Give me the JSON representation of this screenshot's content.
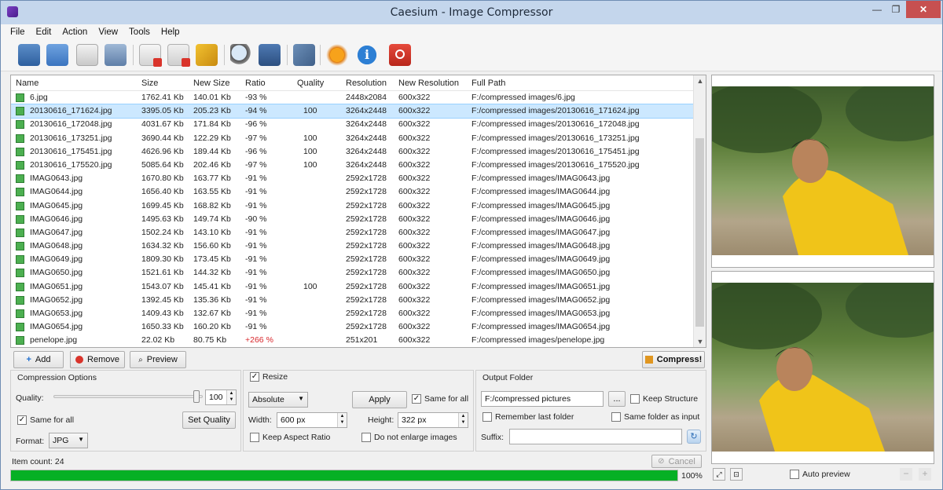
{
  "window": {
    "title": "Caesium - Image Compressor",
    "min": "—",
    "max": "❐",
    "close": "✕"
  },
  "menu": [
    "File",
    "Edit",
    "Action",
    "View",
    "Tools",
    "Help"
  ],
  "list": {
    "columns": [
      "Name",
      "Size",
      "New Size",
      "Ratio",
      "Quality",
      "Resolution",
      "New Resolution",
      "Full Path"
    ],
    "rows": [
      [
        "6.jpg",
        "1762.41 Kb",
        "140.01 Kb",
        "-93 %",
        "",
        "2448x2084",
        "600x322",
        "F:/compressed images/6.jpg"
      ],
      [
        "20130616_171624.jpg",
        "3395.05 Kb",
        "205.23 Kb",
        "-94 %",
        "100",
        "3264x2448",
        "600x322",
        "F:/compressed images/20130616_171624.jpg"
      ],
      [
        "20130616_172048.jpg",
        "4031.67 Kb",
        "171.84 Kb",
        "-96 %",
        "",
        "3264x2448",
        "600x322",
        "F:/compressed images/20130616_172048.jpg"
      ],
      [
        "20130616_173251.jpg",
        "3690.44 Kb",
        "122.29 Kb",
        "-97 %",
        "100",
        "3264x2448",
        "600x322",
        "F:/compressed images/20130616_173251.jpg"
      ],
      [
        "20130616_175451.jpg",
        "4626.96 Kb",
        "189.44 Kb",
        "-96 %",
        "100",
        "3264x2448",
        "600x322",
        "F:/compressed images/20130616_175451.jpg"
      ],
      [
        "20130616_175520.jpg",
        "5085.64 Kb",
        "202.46 Kb",
        "-97 %",
        "100",
        "3264x2448",
        "600x322",
        "F:/compressed images/20130616_175520.jpg"
      ],
      [
        "IMAG0643.jpg",
        "1670.80 Kb",
        "163.77 Kb",
        "-91 %",
        "",
        "2592x1728",
        "600x322",
        "F:/compressed images/IMAG0643.jpg"
      ],
      [
        "IMAG0644.jpg",
        "1656.40 Kb",
        "163.55 Kb",
        "-91 %",
        "",
        "2592x1728",
        "600x322",
        "F:/compressed images/IMAG0644.jpg"
      ],
      [
        "IMAG0645.jpg",
        "1699.45 Kb",
        "168.82 Kb",
        "-91 %",
        "",
        "2592x1728",
        "600x322",
        "F:/compressed images/IMAG0645.jpg"
      ],
      [
        "IMAG0646.jpg",
        "1495.63 Kb",
        "149.74 Kb",
        "-90 %",
        "",
        "2592x1728",
        "600x322",
        "F:/compressed images/IMAG0646.jpg"
      ],
      [
        "IMAG0647.jpg",
        "1502.24 Kb",
        "143.10 Kb",
        "-91 %",
        "",
        "2592x1728",
        "600x322",
        "F:/compressed images/IMAG0647.jpg"
      ],
      [
        "IMAG0648.jpg",
        "1634.32 Kb",
        "156.60 Kb",
        "-91 %",
        "",
        "2592x1728",
        "600x322",
        "F:/compressed images/IMAG0648.jpg"
      ],
      [
        "IMAG0649.jpg",
        "1809.30 Kb",
        "173.45 Kb",
        "-91 %",
        "",
        "2592x1728",
        "600x322",
        "F:/compressed images/IMAG0649.jpg"
      ],
      [
        "IMAG0650.jpg",
        "1521.61 Kb",
        "144.32 Kb",
        "-91 %",
        "",
        "2592x1728",
        "600x322",
        "F:/compressed images/IMAG0650.jpg"
      ],
      [
        "IMAG0651.jpg",
        "1543.07 Kb",
        "145.41 Kb",
        "-91 %",
        "100",
        "2592x1728",
        "600x322",
        "F:/compressed images/IMAG0651.jpg"
      ],
      [
        "IMAG0652.jpg",
        "1392.45 Kb",
        "135.36 Kb",
        "-91 %",
        "",
        "2592x1728",
        "600x322",
        "F:/compressed images/IMAG0652.jpg"
      ],
      [
        "IMAG0653.jpg",
        "1409.43 Kb",
        "132.67 Kb",
        "-91 %",
        "",
        "2592x1728",
        "600x322",
        "F:/compressed images/IMAG0653.jpg"
      ],
      [
        "IMAG0654.jpg",
        "1650.33 Kb",
        "160.20 Kb",
        "-91 %",
        "",
        "2592x1728",
        "600x322",
        "F:/compressed images/IMAG0654.jpg"
      ],
      [
        "penelope.jpg",
        "22.02 Kb",
        "80.75 Kb",
        "+266 %",
        "",
        "251x201",
        "600x322",
        "F:/compressed images/penelope.jpg"
      ]
    ],
    "selected_row": 1
  },
  "buttons": {
    "add": "Add",
    "remove": "Remove",
    "preview": "Preview",
    "compress": "Compress!",
    "apply": "Apply",
    "set_quality": "Set Quality",
    "cancel": "Cancel"
  },
  "compression": {
    "legend": "Compression Options",
    "quality_label": "Quality:",
    "quality_value": "100",
    "same_for_all": "Same for all",
    "format_label": "Format:",
    "format_value": "JPG"
  },
  "resize": {
    "label": "Resize",
    "mode": "Absolute",
    "same_for_all": "Same for all",
    "width_label": "Width:",
    "width_value": "600 px",
    "height_label": "Height:",
    "height_value": "322 px",
    "keep_aspect": "Keep Aspect Ratio",
    "no_enlarge": "Do not enlarge images"
  },
  "output": {
    "legend": "Output Folder",
    "path": "F:/compressed pictures",
    "browse": "...",
    "keep_structure": "Keep Structure",
    "remember_last": "Remember last folder",
    "same_as_input": "Same folder as input",
    "suffix_label": "Suffix:",
    "suffix_value": ""
  },
  "status": {
    "item_count": "Item count: 24",
    "progress_text": "100%",
    "progress_fraction": 1.0
  },
  "preview": {
    "auto_preview": "Auto preview"
  },
  "colors": {
    "accent": "#06b025",
    "selection": "#cce8ff",
    "positive_ratio": "#d8262b"
  }
}
